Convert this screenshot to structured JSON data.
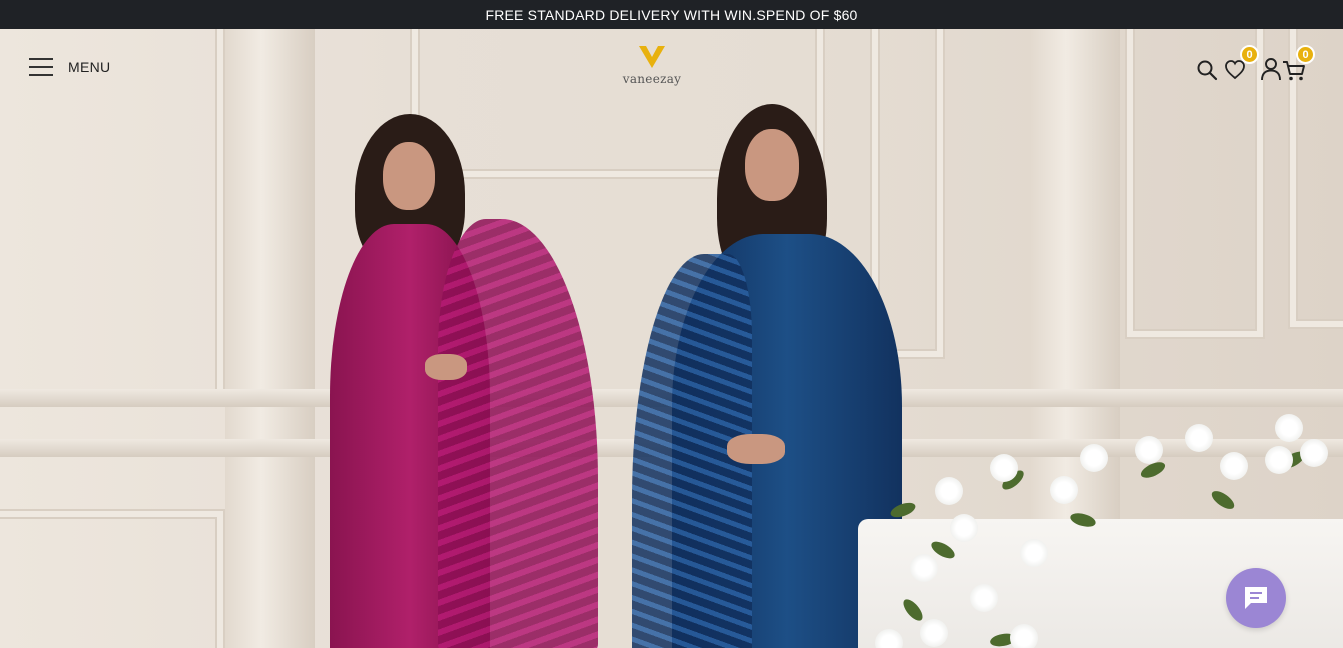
{
  "announcement": "FREE STANDARD DELIVERY WITH WIN.SPEND OF $60",
  "header": {
    "menu_label": "MENU",
    "logo_text": "vaneezay",
    "icons": [
      "search-icon",
      "heart-icon",
      "user-icon",
      "cart-icon"
    ],
    "wishlist_count": "0",
    "cart_count": "0"
  },
  "hero": {
    "figures": [
      "magenta-outfit-model",
      "navy-outfit-model"
    ]
  },
  "colors": {
    "announcement_bg": "#1f2226",
    "badge": "#e8b10e",
    "logo_gold": "#e8b10e",
    "chat_button": "#9b86d4"
  },
  "chat": {
    "icon": "chat-icon"
  }
}
